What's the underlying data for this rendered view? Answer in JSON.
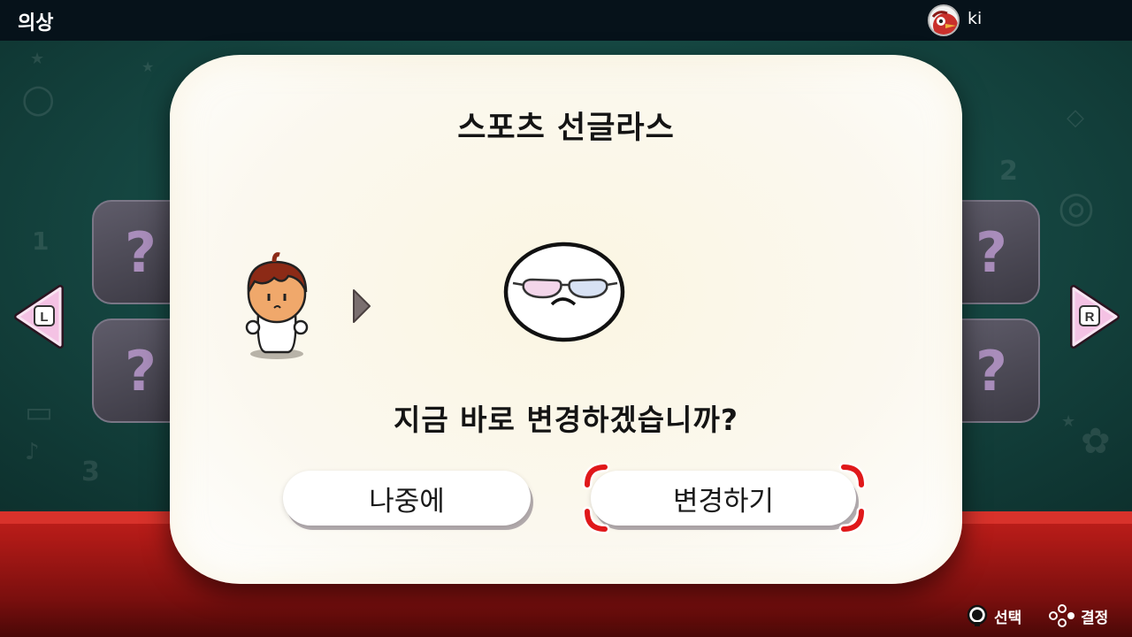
{
  "header": {
    "title": "의상",
    "user_name": "ki"
  },
  "nav": {
    "left_label": "L",
    "right_label": "R"
  },
  "side_cards": [
    "?",
    "?",
    "?",
    "?"
  ],
  "dialog": {
    "item_name": "스포츠 선글라스",
    "question": "지금 바로 변경하겠습니까?",
    "later_button": "나중에",
    "change_button": "변경하기"
  },
  "footer": {
    "select_label": "선택",
    "confirm_label": "결정"
  },
  "colors": {
    "accent_cursor": "#e0181a",
    "nav_arrow_fill": "#f4c2e4",
    "stage_red": "#c0201c",
    "board_green": "#1c5a53"
  }
}
